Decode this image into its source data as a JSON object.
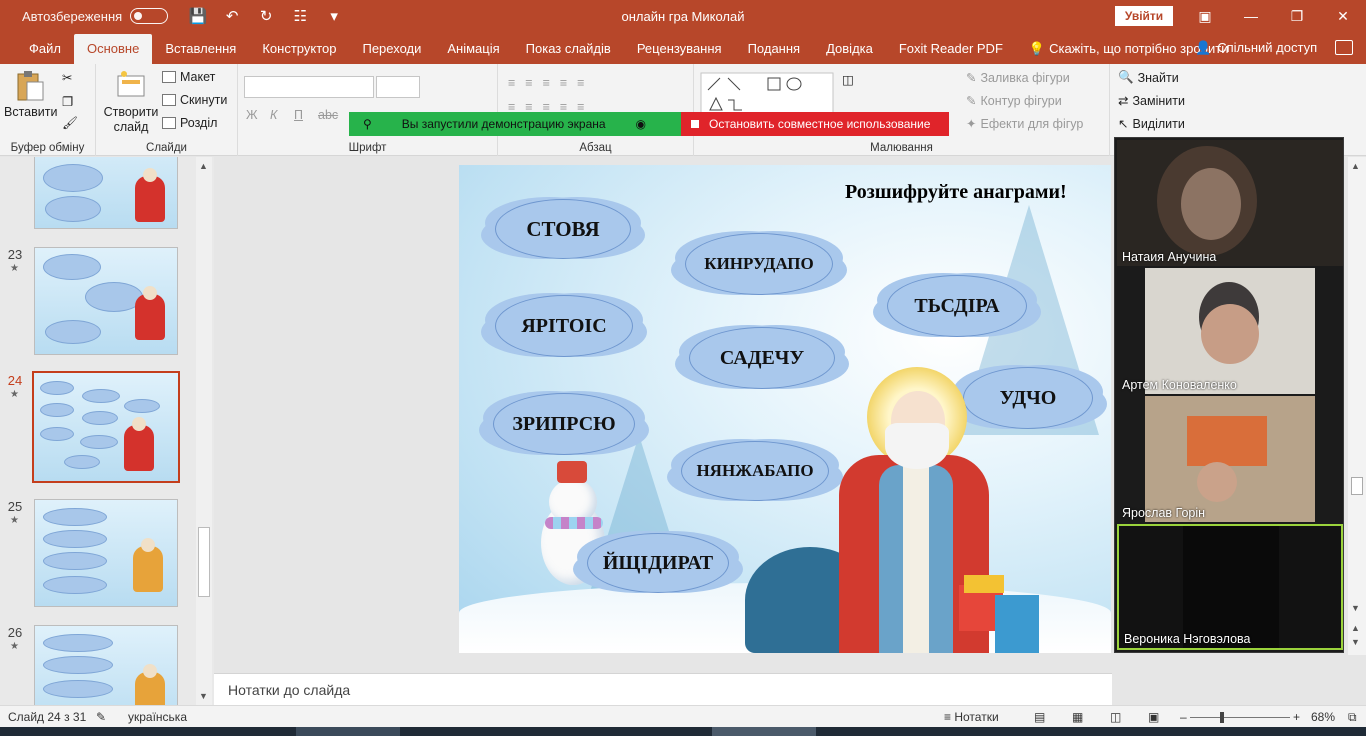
{
  "titlebar": {
    "autosave": "Автозбереження",
    "doc_title": "онлайн гра Миколай",
    "signin": "Увійти"
  },
  "tabs": [
    "Файл",
    "Основне",
    "Вставлення",
    "Конструктор",
    "Переходи",
    "Анімація",
    "Показ слайдів",
    "Рецензування",
    "Подання",
    "Довідка",
    "Foxit Reader PDF"
  ],
  "tellme": "Скажіть, що потрібно зробити",
  "share": "Спільний доступ",
  "ribbon": {
    "paste": "Вставити",
    "clipboard": "Буфер обміну",
    "new_slide_1": "Створити",
    "new_slide_2": "слайд",
    "layout": "Макет",
    "reset": "Скинути",
    "section": "Розділ",
    "slides": "Слайди",
    "font": "Шрифт",
    "bold": "Ж",
    "italic": "К",
    "underline": "П",
    "abc": "abc",
    "paragraph": "Абзац",
    "drawing": "Малювання",
    "shape_fill": "Заливка фігури",
    "shape_outline": "Контур фігури",
    "shape_effects": "Ефекти для фігур",
    "find": "Знайти",
    "replace": "Замінити",
    "select": "Виділити"
  },
  "sharebar": {
    "green": "Вы запустили демонстрацию экрана",
    "red": "Остановить совместное использование"
  },
  "thumbnails": [
    {
      "num": "23",
      "active": false
    },
    {
      "num": "24",
      "active": true
    },
    {
      "num": "25",
      "active": false
    },
    {
      "num": "26",
      "active": false
    }
  ],
  "slide": {
    "title": "Розшифруйте анаграми!",
    "words": [
      "СТОВЯ",
      "КИНРУДАПО",
      "ТЬСДІРА",
      "ЯРІТОІС",
      "САДЕЧУ",
      "УДЧО",
      "ЗРИПРСЮ",
      "НЯНЖАБАПО",
      "ЙЩІДИРАТ"
    ]
  },
  "notes_placeholder": "Нотатки до слайда",
  "participants": [
    "Натаия Анучина",
    "Артем Коноваленко",
    "Ярослав Горін",
    "Вероника Нэговэлова"
  ],
  "status": {
    "slide": "Слайд 24 з 31",
    "language": "українська",
    "notes": "Нотатки",
    "zoom": "68%"
  },
  "colors": {
    "accent": "#b7472a",
    "active_thumb": "#c43e1c",
    "cloud": "#a9c8ec",
    "share_green": "#27b34b",
    "share_red": "#e0242a"
  }
}
